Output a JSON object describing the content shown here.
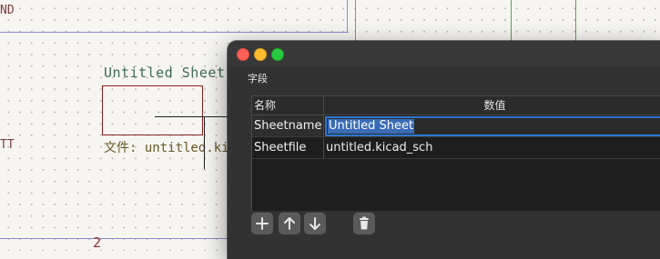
{
  "schematic": {
    "tag_top": "ND",
    "tag_left": "TT",
    "sheet_title": "Untitled Sheet",
    "sheet_file": "文件: untitled.kic",
    "page_number": "2"
  },
  "dialog": {
    "section_label": "字段",
    "columns": {
      "name": "名称",
      "value": "数值"
    },
    "fields": [
      {
        "name": "Sheetname",
        "value": "Untitled Sheet"
      },
      {
        "name": "Sheetfile",
        "value": "untitled.kicad_sch"
      }
    ],
    "toolbar_icons": [
      "plus-icon",
      "arrow-up-icon",
      "arrow-down-icon",
      "trash-icon"
    ],
    "colors": {
      "accent": "#2b78d4",
      "selection": "#3a6cb6",
      "close": "#fe5f57",
      "minimize": "#febc2e",
      "maximize": "#28c840"
    }
  }
}
